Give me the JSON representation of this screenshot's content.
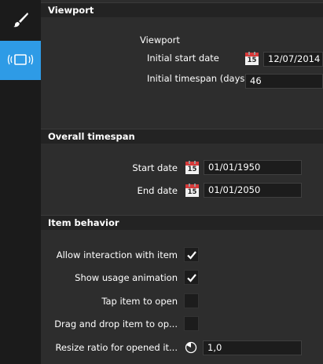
{
  "rail": {
    "items": [
      {
        "icon": "paintbrush-icon",
        "active": false
      },
      {
        "icon": "viewport-icon",
        "active": true
      }
    ],
    "accent": "#2e9be6"
  },
  "viewport": {
    "section_title": "Viewport",
    "group_title": "Viewport",
    "start_date_label": "Initial start date",
    "start_date_value": "12/07/2014",
    "timespan_label": "Initial timespan (days)",
    "timespan_value": "46",
    "calendar_day": "15"
  },
  "overall": {
    "section_title": "Overall timespan",
    "start_label": "Start date",
    "start_value": "01/01/1950",
    "end_label": "End date",
    "end_value": "01/01/2050",
    "calendar_day": "15"
  },
  "behavior": {
    "section_title": "Item behavior",
    "options": [
      {
        "label": "Allow interaction with item",
        "checked": true
      },
      {
        "label": "Show usage animation",
        "checked": true
      },
      {
        "label": "Tap item to open",
        "checked": false
      },
      {
        "label": "Drag and drop item to op...",
        "checked": false
      }
    ],
    "resize_label": "Resize ratio for opened it...",
    "resize_value": "1,0"
  }
}
